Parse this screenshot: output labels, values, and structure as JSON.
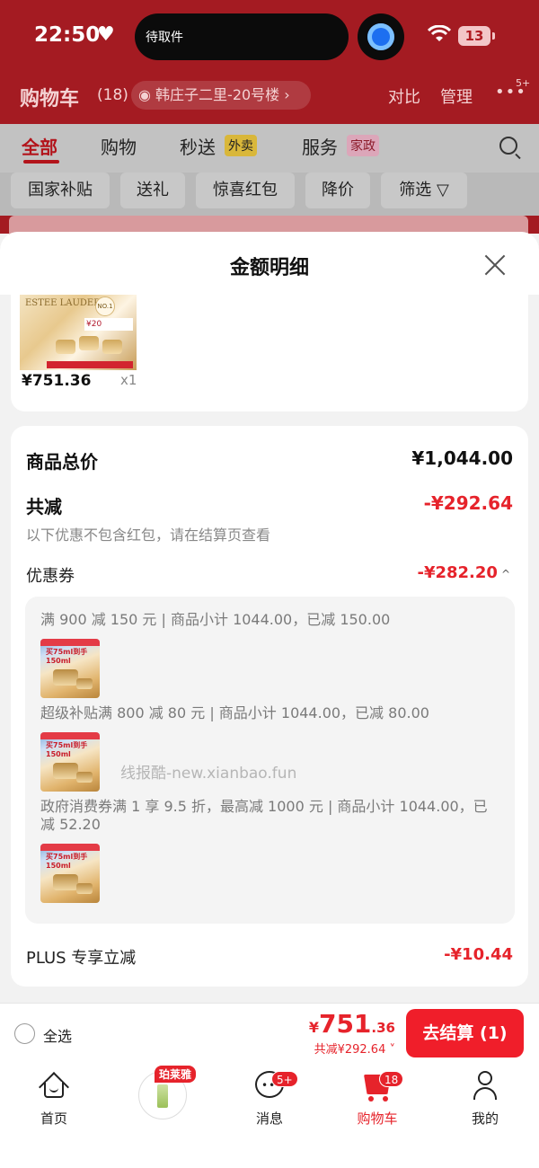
{
  "status_bar": {
    "time": "22:50",
    "live_activity": "待取件",
    "battery": "13"
  },
  "cart_header": {
    "title": "购物车",
    "count": "(18)",
    "address": "韩庄子二里-20号楼",
    "compare": "对比",
    "manage": "管理",
    "more_badge": "5+"
  },
  "cart_tabs": {
    "all": "全部",
    "shopping": "购物",
    "instant": "秒送",
    "instant_tag": "外卖",
    "service": "服务",
    "service_tag": "家政"
  },
  "filter_chips": [
    "国家补贴",
    "送礼",
    "惊喜红包",
    "降价",
    "筛选"
  ],
  "sheet": {
    "title": "金额明细",
    "product": {
      "image_brand": "ESTEE LAUDER",
      "image_badge": "NO.1",
      "image_promo": "¥20",
      "price": "¥751.36",
      "qty": "x1"
    },
    "detail": {
      "total_label": "商品总价",
      "total_value": "¥1,044.00",
      "reduce_label": "共减",
      "reduce_value": "-¥292.64",
      "reduce_note": "以下优惠不包含红包，请在结算页查看",
      "coupon_label": "优惠券",
      "coupon_value": "-¥282.20",
      "coupon_lines": [
        "满 900 减 150 元 | 商品小计 1044.00，已减 150.00",
        "超级补贴满 800 减 80 元 | 商品小计 1044.00，已减 80.00",
        "政府消费券满 1 享 9.5 折，最高减 1000 元 | 商品小计 1044.00，已减 52.20"
      ],
      "thumb_caption": "买75ml到手150ml",
      "watermark": "线报酷-new.xianbao.fun",
      "plus_label": "PLUS 专享立减",
      "plus_value": "-¥10.44"
    }
  },
  "checkout": {
    "select_all": "全选",
    "currency": "¥",
    "total_int": "751",
    "total_dec": ".36",
    "saved": "共减¥292.64",
    "pay_button": "去结算 (1)"
  },
  "bottom_nav": {
    "home": "首页",
    "brand_tag": "珀莱雅",
    "messages": "消息",
    "messages_badge": "5+",
    "cart": "购物车",
    "cart_badge": "18",
    "me": "我的"
  },
  "colors": {
    "brand_red": "#e6232b",
    "header_red": "#c8222a",
    "sheet_bg": "#f2f2f2"
  }
}
